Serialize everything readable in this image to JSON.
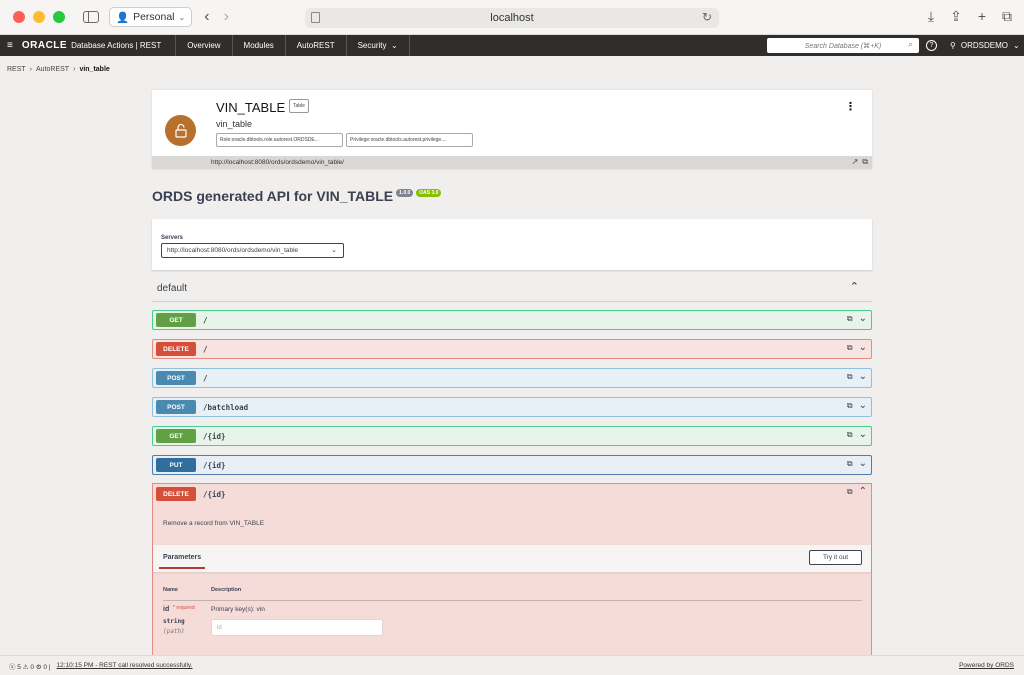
{
  "browser": {
    "profile": "Personal",
    "address": "localhost"
  },
  "header": {
    "brand": "ORACLE",
    "product": "Database Actions | REST",
    "nav": [
      "Overview",
      "Modules",
      "AutoREST",
      "Security"
    ],
    "search_placeholder": "Search Database (⌘+K)",
    "user": "ORDSDEMO"
  },
  "breadcrumb": [
    "REST",
    "AutoREST",
    "vin_table"
  ],
  "object": {
    "name": "VIN_TABLE",
    "type_badge": "Table",
    "alias": "vin_table",
    "role_chip": "Role:oracle.dbtools.role.autorest.ORDSDE...",
    "privilege_chip": "Privilege:oracle.dbtools.autorest.privilege....",
    "url": "http://localhost:8080/ords/ordsdemo/vin_table/"
  },
  "api": {
    "title": "ORDS generated API for VIN_TABLE",
    "version": "1.0.0",
    "oas": "OAS 3.0",
    "servers_label": "Servers",
    "server": "http://localhost:8080/ords/ordsdemo/vin_table",
    "section": "default"
  },
  "operations": [
    {
      "method": "GET",
      "path": "/"
    },
    {
      "method": "DELETE",
      "path": "/"
    },
    {
      "method": "POST",
      "path": "/"
    },
    {
      "method": "POST",
      "path": "/batchload"
    },
    {
      "method": "GET",
      "path": "/{id}"
    },
    {
      "method": "PUT",
      "path": "/{id}"
    },
    {
      "method": "DELETE",
      "path": "/{id}"
    }
  ],
  "expanded": {
    "description": "Remove a record from VIN_TABLE",
    "params_tab": "Parameters",
    "try_button": "Try it out",
    "col_name": "Name",
    "col_desc": "Description",
    "param_name": "id",
    "param_required": "* required",
    "param_type": "string",
    "param_in": "(path)",
    "param_desc": "Primary key(s): vin",
    "param_placeholder": "id"
  },
  "status": {
    "counts": "ⓧ 5 ⚠ 0 ⚙ 0 |",
    "message": "12:10:15 PM - REST call resolved successfully.",
    "powered": "Powered by ORDS"
  }
}
